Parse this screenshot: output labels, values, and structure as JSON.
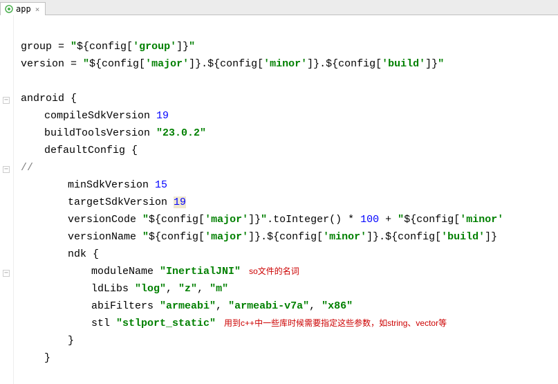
{
  "tab": {
    "label": "app"
  },
  "code": {
    "group_assign": {
      "lhs": "group",
      "eq": " = ",
      "q": "\"",
      "d1": "${config[",
      "g": "'group'",
      "d2": "]}",
      "qe": "\""
    },
    "version_assign": {
      "lhs": "version",
      "eq": " = ",
      "q": "\"",
      "p1": "${config[",
      "major": "'major'",
      "p2": "]}.${config[",
      "minor": "'minor'",
      "p3": "]}.${config[",
      "build": "'build'",
      "p4": "]}",
      "qe": "\""
    },
    "android": "android {",
    "compileSdk": {
      "k": "compileSdkVersion ",
      "v": "19"
    },
    "buildTools": {
      "k": "buildToolsVersion ",
      "v": "\"23.0.2\""
    },
    "defaultConfig": "defaultConfig {",
    "commentSlashes": "//",
    "minSdk": {
      "k": "minSdkVersion ",
      "v": "15"
    },
    "targetSdk": {
      "k": "targetSdkVersion ",
      "hl": "19"
    },
    "versionCode": {
      "k": "versionCode ",
      "q": "\"",
      "p1": "${config[",
      "major": "'major'",
      "p2": "]}",
      "qe": "\"",
      "tail1": ".toInteger() * ",
      "n100": "100",
      "plus": " + ",
      "q2": "\"",
      "p3": "${config[",
      "minor2": "'minor'"
    },
    "versionName": {
      "k": "versionName ",
      "q": "\"",
      "p1": "${config[",
      "major": "'major'",
      "p2": "]}.${config[",
      "minor": "'minor'",
      "p3": "]}.${config[",
      "build": "'build'",
      "p4": "]}"
    },
    "ndk": "ndk {",
    "moduleName": {
      "k": "moduleName ",
      "v": "\"InertialJNI\"",
      "note": "so文件的名词"
    },
    "ldLibs": {
      "k": "ldLibs ",
      "v1": "\"log\"",
      "c1": ", ",
      "v2": "\"z\"",
      "c2": ", ",
      "v3": "\"m\""
    },
    "abiFilters": {
      "k": "abiFilters ",
      "v1": "\"armeabi\"",
      "c1": ", ",
      "v2": "\"armeabi-v7a\"",
      "c2": ", ",
      "v3": "\"x86\""
    },
    "stl": {
      "k": "stl ",
      "v": "\"stlport_static\"",
      "note": "用到c++中一些库时候需要指定这些参数，如string、vector等"
    },
    "brace": "}"
  }
}
